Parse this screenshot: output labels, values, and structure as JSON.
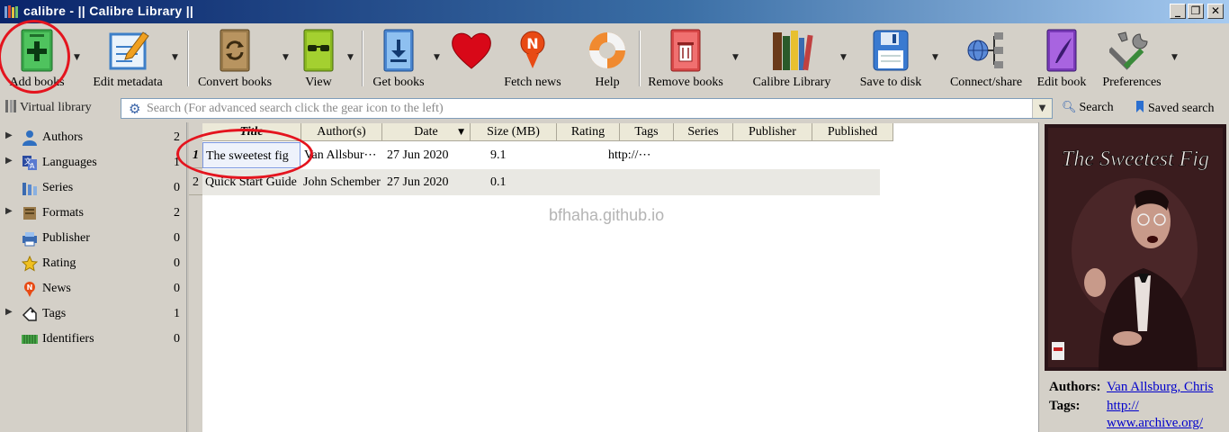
{
  "window": {
    "title": "calibre - || Calibre Library ||",
    "controls": [
      "_",
      "❐",
      "✕"
    ]
  },
  "toolbar": {
    "items": [
      {
        "label": "Add books",
        "icon": "add-books-icon"
      },
      {
        "label": "Edit metadata",
        "icon": "edit-metadata-icon"
      },
      {
        "label": "Convert books",
        "icon": "convert-books-icon"
      },
      {
        "label": "View",
        "icon": "view-icon"
      },
      {
        "label": "Get books",
        "icon": "get-books-icon"
      },
      {
        "label": "",
        "icon": "heart-icon"
      },
      {
        "label": "Fetch news",
        "icon": "fetch-news-icon"
      },
      {
        "label": "Help",
        "icon": "help-lifebuoy-icon"
      },
      {
        "label": "Remove books",
        "icon": "remove-books-icon"
      },
      {
        "label": "Calibre Library",
        "icon": "library-icon"
      },
      {
        "label": "Save to disk",
        "icon": "save-disk-icon"
      },
      {
        "label": "Connect/share",
        "icon": "connect-share-icon"
      },
      {
        "label": "Edit book",
        "icon": "edit-book-icon"
      },
      {
        "label": "Preferences",
        "icon": "preferences-icon"
      }
    ],
    "dropdown_arrow": "▼"
  },
  "searchbar": {
    "virtual_library": "Virtual library",
    "placeholder": "Search (For advanced search click the gear icon to the left)",
    "search_label": "Search",
    "saved_search_label": "Saved search"
  },
  "tag_browser": {
    "items": [
      {
        "label": "Authors",
        "count": "2",
        "expandable": true,
        "icon": "authors-icon"
      },
      {
        "label": "Languages",
        "count": "1",
        "expandable": true,
        "icon": "languages-icon"
      },
      {
        "label": "Series",
        "count": "0",
        "expandable": false,
        "icon": "series-icon"
      },
      {
        "label": "Formats",
        "count": "2",
        "expandable": true,
        "icon": "formats-icon"
      },
      {
        "label": "Publisher",
        "count": "0",
        "expandable": false,
        "icon": "publisher-icon"
      },
      {
        "label": "Rating",
        "count": "0",
        "expandable": false,
        "icon": "rating-star-icon"
      },
      {
        "label": "News",
        "count": "0",
        "expandable": false,
        "icon": "news-icon"
      },
      {
        "label": "Tags",
        "count": "1",
        "expandable": true,
        "icon": "tags-icon"
      },
      {
        "label": "Identifiers",
        "count": "0",
        "expandable": false,
        "icon": "identifiers-icon"
      }
    ],
    "expand_glyph": "▶"
  },
  "book_list": {
    "columns": [
      "Title",
      "Author(s)",
      "Date",
      "Size (MB)",
      "Rating",
      "Tags",
      "Series",
      "Publisher",
      "Published"
    ],
    "sorted_column": "Title",
    "rows": [
      {
        "num": "1",
        "title": "The sweetest fig",
        "authors": "Van Allsbur⋯",
        "date": "27 Jun 2020",
        "size": "9.1",
        "rating": "",
        "tags": "http://⋯",
        "series": "",
        "publisher": "",
        "published": ""
      },
      {
        "num": "2",
        "title": "Quick Start Guide",
        "authors": "John Schember",
        "date": "27 Jun 2020",
        "size": "0.1",
        "rating": "",
        "tags": "",
        "series": "",
        "publisher": "",
        "published": ""
      }
    ],
    "watermark": "bfhaha.github.io"
  },
  "book_details": {
    "cover_title": "The Sweetest Fig",
    "authors_label": "Authors:",
    "authors_value": "Van Allsburg, Chris",
    "tags_label": "Tags:",
    "tags_value_1": "http://",
    "tags_value_2": "www.archive.org/"
  },
  "colors": {
    "annotation": "#e4141e",
    "titlebar": "#0a246a",
    "link": "#0000cc"
  }
}
